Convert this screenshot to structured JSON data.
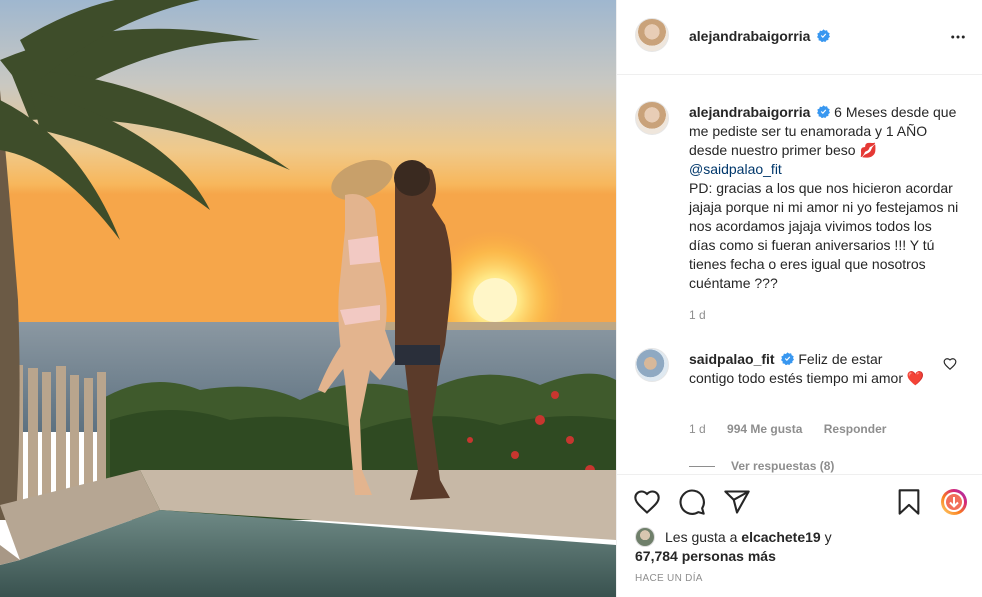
{
  "post": {
    "image_alt": "Couple kissing at sunset by the ocean"
  },
  "header": {
    "username": "alejandrabaigorria",
    "more_icon": "more-horizontal-icon"
  },
  "caption": {
    "username": "alejandrabaigorria",
    "text_part1": "6 Meses desde que me pediste ser tu enamorada y 1 AÑO desde nuestro primer beso",
    "emoji": "💋",
    "mention": "@saidpalao_fit",
    "text_part2": "PD: gracias a los que nos hicieron acordar jajaja porque ni mi amor ni yo festejamos ni nos acordamos jajaja vivimos todos los días como si fueran aniversarios !!! Y tú tienes fecha o eres igual que nosotros cuéntame ???",
    "time": "1 d"
  },
  "comment": {
    "username": "saidpalao_fit",
    "text": "Feliz de estar contigo todo estés tiempo mi amor",
    "emoji": "❤️",
    "time": "1 d",
    "likes": "994 Me gusta",
    "reply_label": "Responder",
    "view_replies": "Ver respuestas (8)"
  },
  "actions": {
    "icons": [
      "heart-icon",
      "comment-icon",
      "share-icon",
      "bookmark-icon",
      "avatar-story-icon"
    ]
  },
  "likes": {
    "prefix": "Les gusta a",
    "user": "elcachete19",
    "joiner": "y",
    "count": "67,784 personas más"
  },
  "date": "HACE UN DÍA",
  "colors": {
    "text": "#262626",
    "secondary": "#8e8e8e",
    "link": "#00376b",
    "verified": "#3897f0",
    "heart": "#ed4956"
  }
}
